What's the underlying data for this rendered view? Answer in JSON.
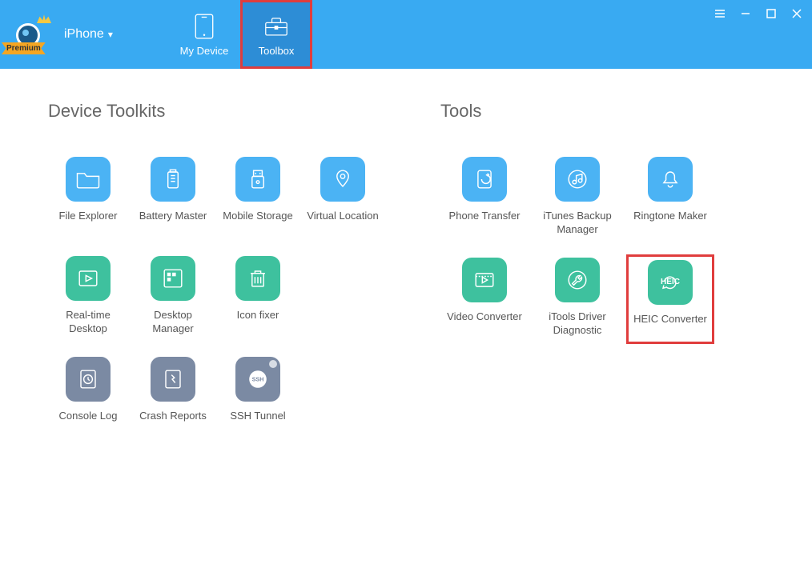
{
  "premium_label": "Premium",
  "device_selector": "iPhone",
  "nav": {
    "my_device": "My Device",
    "toolbox": "Toolbox"
  },
  "sections": {
    "device_toolkits": {
      "title": "Device Toolkits",
      "items": [
        {
          "label": "File Explorer",
          "color": "blue"
        },
        {
          "label": "Battery Master",
          "color": "blue"
        },
        {
          "label": "Mobile Storage",
          "color": "blue"
        },
        {
          "label": "Virtual Location",
          "color": "blue"
        },
        {
          "label": "Real-time Desktop",
          "color": "green"
        },
        {
          "label": "Desktop Manager",
          "color": "green"
        },
        {
          "label": "Icon fixer",
          "color": "green"
        },
        {
          "label": "Console Log",
          "color": "grayblue"
        },
        {
          "label": "Crash Reports",
          "color": "grayblue"
        },
        {
          "label": "SSH Tunnel",
          "color": "grayblue"
        }
      ]
    },
    "tools": {
      "title": "Tools",
      "items": [
        {
          "label": "Phone Transfer",
          "color": "blue"
        },
        {
          "label": "iTunes Backup Manager",
          "color": "blue"
        },
        {
          "label": "Ringtone Maker",
          "color": "blue"
        },
        {
          "label": "Video Converter",
          "color": "green"
        },
        {
          "label": "iTools Driver Diagnostic",
          "color": "green"
        },
        {
          "label": "HEIC Converter",
          "color": "green",
          "highlighted": true
        }
      ]
    }
  }
}
